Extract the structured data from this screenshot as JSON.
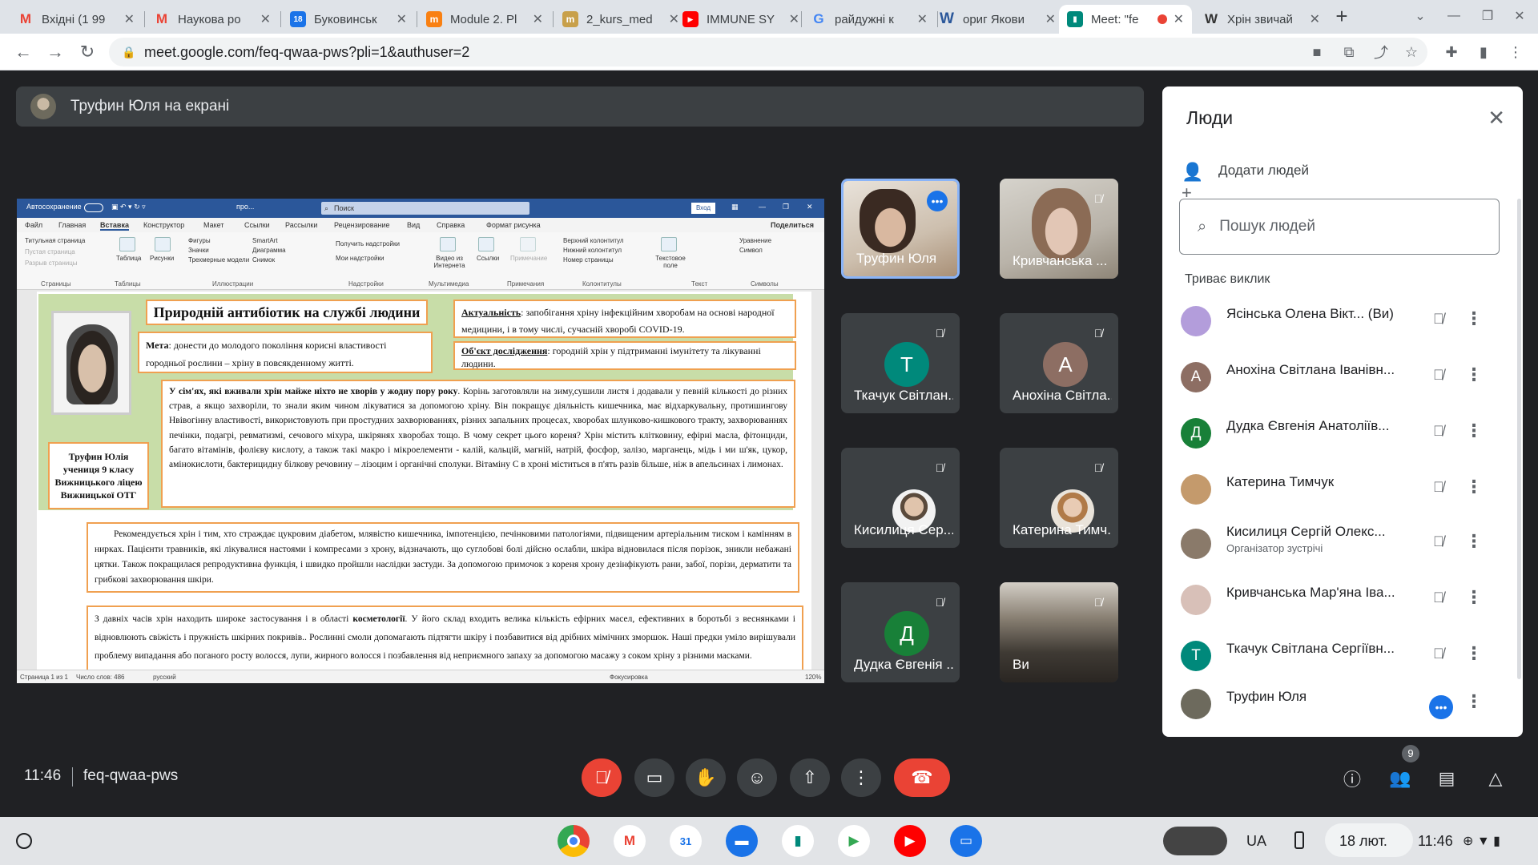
{
  "browser": {
    "tabs": [
      {
        "label": "Вхідні (1 99",
        "icon": "gmail-icon",
        "color": "#ea4335"
      },
      {
        "label": "Наукова ро",
        "icon": "gmail-icon",
        "color": "#ea4335"
      },
      {
        "label": "Буковинськ",
        "icon": "calendar-icon",
        "color": "#1a73e8"
      },
      {
        "label": "Module 2. Pl",
        "icon": "moodle-icon",
        "color": "#f98012"
      },
      {
        "label": "2_kurs_med",
        "icon": "moodle-icon",
        "color": "#c8a04a"
      },
      {
        "label": "IMMUNE SY",
        "icon": "youtube-icon",
        "color": "#ff0000"
      },
      {
        "label": "райдужні к",
        "icon": "google-icon",
        "color": "#4285f4"
      },
      {
        "label": "ориг Якови",
        "icon": "word-icon",
        "color": "#2b579a"
      },
      {
        "label": "Meet: \"fe",
        "icon": "meet-icon",
        "color": "#00897b"
      },
      {
        "label": "Хрін звичай",
        "icon": "wikipedia-icon",
        "color": "#333333"
      }
    ],
    "url": "meet.google.com/feq-qwaa-pws?pli=1&authuser=2"
  },
  "presenter": {
    "text": "Труфин Юля на екрані"
  },
  "doc": {
    "autosave": "Автосохранение",
    "search": "Поиск",
    "signin": "Вход",
    "share": "Поделиться",
    "menu": [
      "Файл",
      "Главная",
      "Вставка",
      "Конструктор",
      "Макет",
      "Ссылки",
      "Рассылки",
      "Рецензирование",
      "Вид",
      "Справка",
      "Формат рисунка"
    ],
    "ribbon_groups": [
      "Страницы",
      "Таблицы",
      "Иллюстрации",
      "Надстройки",
      "Мультимедиа",
      "Примечания",
      "Колонтитулы",
      "Текст",
      "Символы"
    ],
    "ribbon_items": {
      "pages": [
        "Титульная страница",
        "Пустая страница",
        "Разрыв страницы"
      ],
      "table": "Таблица",
      "pictures": "Рисунки",
      "shapes": "Фигуры",
      "icons": "Значки",
      "models": "Трехмерные модели",
      "smartart": "SmartArt",
      "diagram": "Диаграмма",
      "screenshot": "Снимок",
      "get_addins": "Получить надстройки",
      "my_addins": "Мои надстройки",
      "video": "Видео из Интернета",
      "links": "Ссылки",
      "comment": "Примечание",
      "header": "Верхний колонтитул",
      "footer": "Нижний колонтитул",
      "pagenum": "Номер страницы",
      "textbox": "Текстовое поле",
      "equation": "Уравнение",
      "symbol": "Символ"
    },
    "title": "Природній антибіотик на службі людини",
    "goal_label": "Мета",
    "goal_text": ": донести до молодого покоління корисні властивості городньої рослини – хріну в повсякденному житті.",
    "relevance_label": "Актуальність",
    "relevance_text": ": запобігання хріну інфекційним хворобам на основі народної медицини, і в тому числі, сучасній хворобі COVID-19.",
    "object_label": "Об'єкт дослідження",
    "object_text": ": городній хрін у підтриманні імунітету та лікуванні людини.",
    "author": "Труфин Юлія учениця 9 класу Вижницького ліцею Вижницької ОТГ",
    "p1_bold": "У сім'ях, які вживали хрін майже ніхто не хворів у жодну пору року",
    "p1_text": ". Корінь заготовляли на зиму,сушили листя і додавали у певній кількості до різних страв, а якщо захворіли, то знали яким чином лікуватися за допомогою хріну. Він покращує діяльність кишечника, має відхаркувальну, протишингову Нвівогінну властивості, використовують при простудних захворюваннях, різних запальних процесах, хворобах шлунково-кишкового тракту, захворюваннях печінки, подагрі, ревматизмі, сечового міхура, шкірянях хворобах тощо. В чому секрет цього кореня? Хрін містить клітковину, ефірні масла, фітонциди, багато вітамінів, фолієву кислоту, а також такі макро і мікроелементи - калій, кальцій, магній, натрій, фосфор, залізо, марганець, мідь і ми ш'як, цукор, амінокислоти, бактерицидну білкову речовину – лізоцим і органічні сполуки. Вітаміну С в хроні міститься в п'ять разів більше, ніж в апельсинах і лимонах.",
    "p2_text": "Рекомендується хрін і тим, хто страждає цукровим діабетом, млявістю кишечника, імпотенцією, печінковими патологіями, підвищеним артеріальним тиском і камінням в нирках. Пацієнти травників, які лікувалися настоями і компресами з хрону, відзначають, що суглобові болі дійсно ослабли, шкіра відновилася після порізок, зникли небажані цятки. Також покращилася репродуктивна функція, і швидко пройшли наслідки застуди. За допомогою примочок з кореня хрону дезінфікують рани, забої, порізи, дерматити та грибкові захворювання шкіри.",
    "p3_text1": "З давніх часів хрін находить широке застосування і в області ",
    "p3_bold": "косметології",
    "p3_text2": ". У його склад входить велика кількість ефірних масел, ефективних в боротьбі з веснянками і відновлюють свіжість і пружність шкірних покривів.. Рослинні смоли допомагають підтягти шкіру і позбавитися від дрібних мімічних зморшок. Наші предки уміло вирішували проблему випадання або поганого росту волосся, лупи, жирного волосся і позбавлення від неприємного запаху за допомогою масажу з соком хріну з різними масками.",
    "status": {
      "page": "Страница 1 из 1",
      "words": "Число слов: 486",
      "lang": "русский",
      "focus": "Фокусировка",
      "zoom": "120%"
    }
  },
  "tiles": [
    {
      "name": "Труфин Юля",
      "type": "video",
      "status": "speaking"
    },
    {
      "name": "Кривчанська ...",
      "type": "video",
      "status": "muted"
    },
    {
      "name": "Ткачук Світлан...",
      "type": "letter",
      "letter": "T",
      "color": "#00897b",
      "status": "muted"
    },
    {
      "name": "Анохіна Світла...",
      "type": "letter",
      "letter": "A",
      "color": "#8d6e63",
      "status": "muted"
    },
    {
      "name": "Кисилиця Сер...",
      "type": "photo",
      "status": "muted"
    },
    {
      "name": "Катерина Тимч...",
      "type": "photo",
      "status": "muted"
    },
    {
      "name": "Дудка Євгенія ...",
      "type": "letter",
      "letter": "Д",
      "color": "#188038",
      "status": "muted"
    },
    {
      "name": "Ви",
      "type": "video",
      "status": "muted"
    }
  ],
  "people": {
    "title": "Люди",
    "add": "Додати людей",
    "search_placeholder": "Пошук людей",
    "section": "Триває виклик",
    "list": [
      {
        "name": "Ясінська Олена Вікт... (Ви)",
        "role": "",
        "avatar": "photo",
        "color": "#b39ddb"
      },
      {
        "name": "Анохіна Світлана Іванівн...",
        "role": "",
        "avatar": "letter",
        "letter": "A",
        "color": "#8d6e63"
      },
      {
        "name": "Дудка Євгенія Анатоліїв...",
        "role": "",
        "avatar": "letter",
        "letter": "Д",
        "color": "#188038"
      },
      {
        "name": "Катерина Тимчук",
        "role": "",
        "avatar": "photo",
        "color": "#c49a6c"
      },
      {
        "name": "Кисилиця Сергій Олекс...",
        "role": "Організатор зустрічі",
        "avatar": "photo",
        "color": "#8a7a6a"
      },
      {
        "name": "Кривчанська Мар'яна Іва...",
        "role": "",
        "avatar": "photo",
        "color": "#d8c0b8"
      },
      {
        "name": "Ткачук Світлана Сергіївн...",
        "role": "",
        "avatar": "letter",
        "letter": "T",
        "color": "#00897b"
      },
      {
        "name": "Труфин Юля",
        "role": "",
        "avatar": "photo",
        "color": "#6d6a5d"
      }
    ]
  },
  "bottom": {
    "time": "11:46",
    "code": "feq-qwaa-pws",
    "participants_count": "9"
  },
  "shelf": {
    "lang": "UA",
    "date": "18 лют.",
    "time": "11:46"
  }
}
